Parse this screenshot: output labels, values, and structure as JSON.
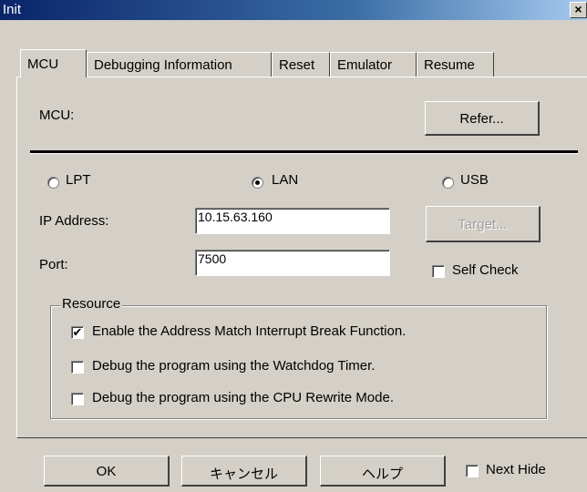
{
  "window": {
    "title": "Init",
    "close_glyph": "×"
  },
  "tabs": [
    {
      "label": "MCU",
      "active": true
    },
    {
      "label": "Debugging Information",
      "active": false
    },
    {
      "label": "Reset",
      "active": false
    },
    {
      "label": "Emulator",
      "active": false
    },
    {
      "label": "Resume",
      "active": false
    }
  ],
  "mcu": {
    "label": "MCU:",
    "refer_button": "Refer..."
  },
  "connection": {
    "options": [
      {
        "label": "LPT",
        "selected": false
      },
      {
        "label": "LAN",
        "selected": true
      },
      {
        "label": "USB",
        "selected": false
      }
    ],
    "ip_label": "IP Address:",
    "ip_value": "10.15.63.160",
    "port_label": "Port:",
    "port_value": "7500",
    "target_button": "Target...",
    "target_enabled": false,
    "self_check_label": "Self Check",
    "self_check_checked": false
  },
  "resource": {
    "legend": "Resource",
    "options": [
      {
        "label": "Enable the Address Match Interrupt Break Function.",
        "checked": true
      },
      {
        "label": "Debug the program using the Watchdog Timer.",
        "checked": false
      },
      {
        "label": "Debug the program using the CPU Rewrite Mode.",
        "checked": false
      }
    ]
  },
  "footer": {
    "ok": "OK",
    "cancel": "キャンセル",
    "help": "ヘルプ",
    "next_hide_label": "Next Hide",
    "next_hide_checked": false
  },
  "colors": {
    "face": "#d4d0c8",
    "title_bar": "#0a246a",
    "disabled_text": "#a0a0a0"
  }
}
